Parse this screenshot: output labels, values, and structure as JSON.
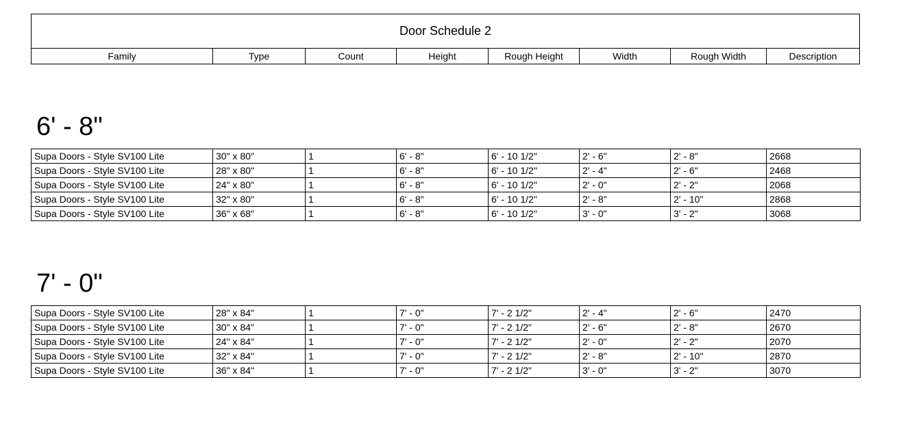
{
  "schedule": {
    "title": "Door Schedule 2",
    "columns": [
      "Family",
      "Type",
      "Count",
      "Height",
      "Rough Height",
      "Width",
      "Rough Width",
      "Description"
    ]
  },
  "groups": [
    {
      "heading": "6' - 8\"",
      "rows": [
        [
          "Supa Doors - Style SV100 Lite",
          "30\" x 80\"",
          "1",
          "6' - 8\"",
          "6' - 10 1/2\"",
          "2' - 6\"",
          "2' - 8\"",
          "2668"
        ],
        [
          "Supa Doors - Style SV100 Lite",
          "28\" x 80\"",
          "1",
          "6' - 8\"",
          "6' - 10 1/2\"",
          "2' - 4\"",
          "2' - 6\"",
          "2468"
        ],
        [
          "Supa Doors - Style SV100 Lite",
          "24\" x 80\"",
          "1",
          "6' - 8\"",
          "6' - 10 1/2\"",
          "2' - 0\"",
          "2' - 2\"",
          "2068"
        ],
        [
          "Supa Doors - Style SV100 Lite",
          "32\" x 80\"",
          "1",
          "6' - 8\"",
          "6' - 10 1/2\"",
          "2' - 8\"",
          "2' - 10\"",
          "2868"
        ],
        [
          "Supa Doors - Style SV100 Lite",
          "36\" x 68\"",
          "1",
          "6' - 8\"",
          "6' - 10 1/2\"",
          "3' - 0\"",
          "3' - 2\"",
          "3068"
        ]
      ]
    },
    {
      "heading": "7' - 0\"",
      "rows": [
        [
          "Supa Doors - Style SV100 Lite",
          "28\" x 84\"",
          "1",
          "7' - 0\"",
          "7' - 2 1/2\"",
          "2' - 4\"",
          "2' - 6\"",
          "2470"
        ],
        [
          "Supa Doors - Style SV100 Lite",
          "30\" x 84\"",
          "1",
          "7' - 0\"",
          "7' - 2 1/2\"",
          "2' - 6\"",
          "2' - 8\"",
          "2670"
        ],
        [
          "Supa Doors - Style SV100 Lite",
          "24\" x 84\"",
          "1",
          "7' - 0\"",
          "7' - 2 1/2\"",
          "2' - 0\"",
          "2' - 2\"",
          "2070"
        ],
        [
          "Supa Doors - Style SV100 Lite",
          "32\" x 84\"",
          "1",
          "7' - 0\"",
          "7' - 2 1/2\"",
          "2' - 8\"",
          "2' - 10\"",
          "2870"
        ],
        [
          "Supa Doors - Style SV100 Lite",
          "36\" x 84\"",
          "1",
          "7' - 0\"",
          "7' - 2 1/2\"",
          "3' - 0\"",
          "3' - 2\"",
          "3070"
        ]
      ]
    }
  ]
}
